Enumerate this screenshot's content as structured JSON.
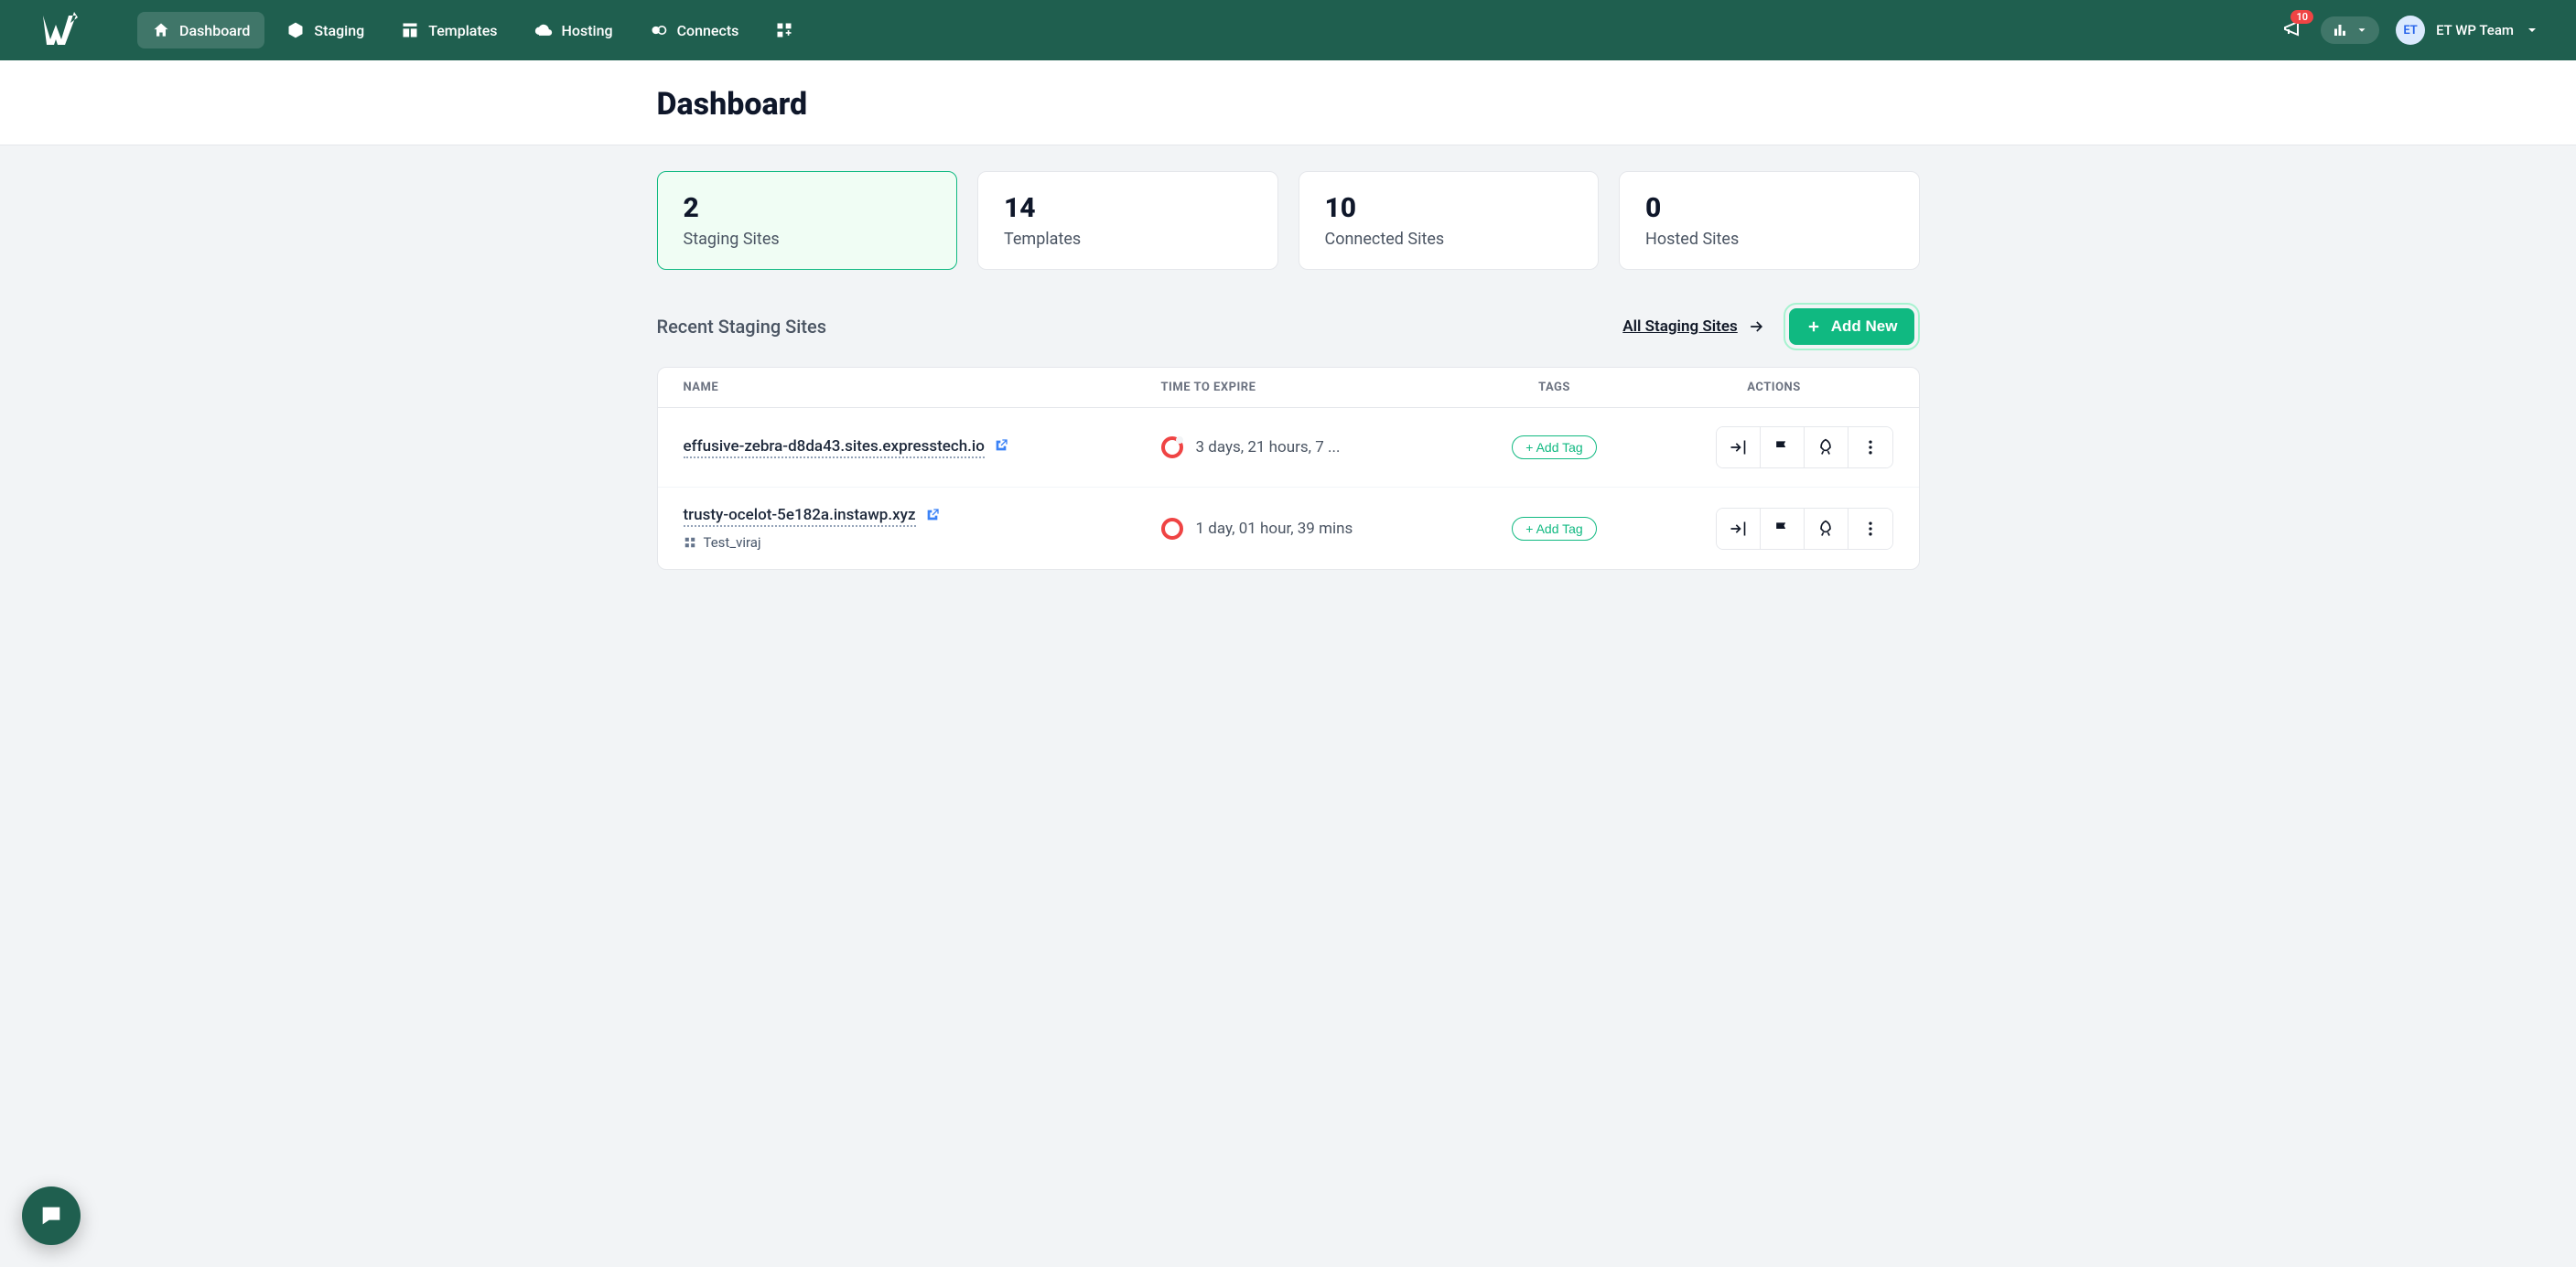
{
  "nav": {
    "items": [
      {
        "label": "Dashboard"
      },
      {
        "label": "Staging"
      },
      {
        "label": "Templates"
      },
      {
        "label": "Hosting"
      },
      {
        "label": "Connects"
      }
    ]
  },
  "topbar": {
    "notification_count": "10",
    "user_initials": "ET",
    "user_name": "ET WP Team"
  },
  "page": {
    "title": "Dashboard"
  },
  "stats": [
    {
      "value": "2",
      "label": "Staging Sites",
      "active": true
    },
    {
      "value": "14",
      "label": "Templates",
      "active": false
    },
    {
      "value": "10",
      "label": "Connected Sites",
      "active": false
    },
    {
      "value": "0",
      "label": "Hosted Sites",
      "active": false
    }
  ],
  "section": {
    "title": "Recent Staging Sites",
    "all_link": "All Staging Sites",
    "add_new": "Add New"
  },
  "table": {
    "columns": [
      "NAME",
      "TIME TO EXPIRE",
      "TAGS",
      "ACTIONS"
    ],
    "add_tag_label": "+ Add Tag",
    "rows": [
      {
        "name": "effusive-zebra-d8da43.sites.expresstech.io",
        "sub": "",
        "expire": "3 days, 21 hours, 7 ..."
      },
      {
        "name": "trusty-ocelot-5e182a.instawp.xyz",
        "sub": "Test_viraj",
        "expire": "1 day, 01 hour, 39 mins"
      }
    ]
  }
}
